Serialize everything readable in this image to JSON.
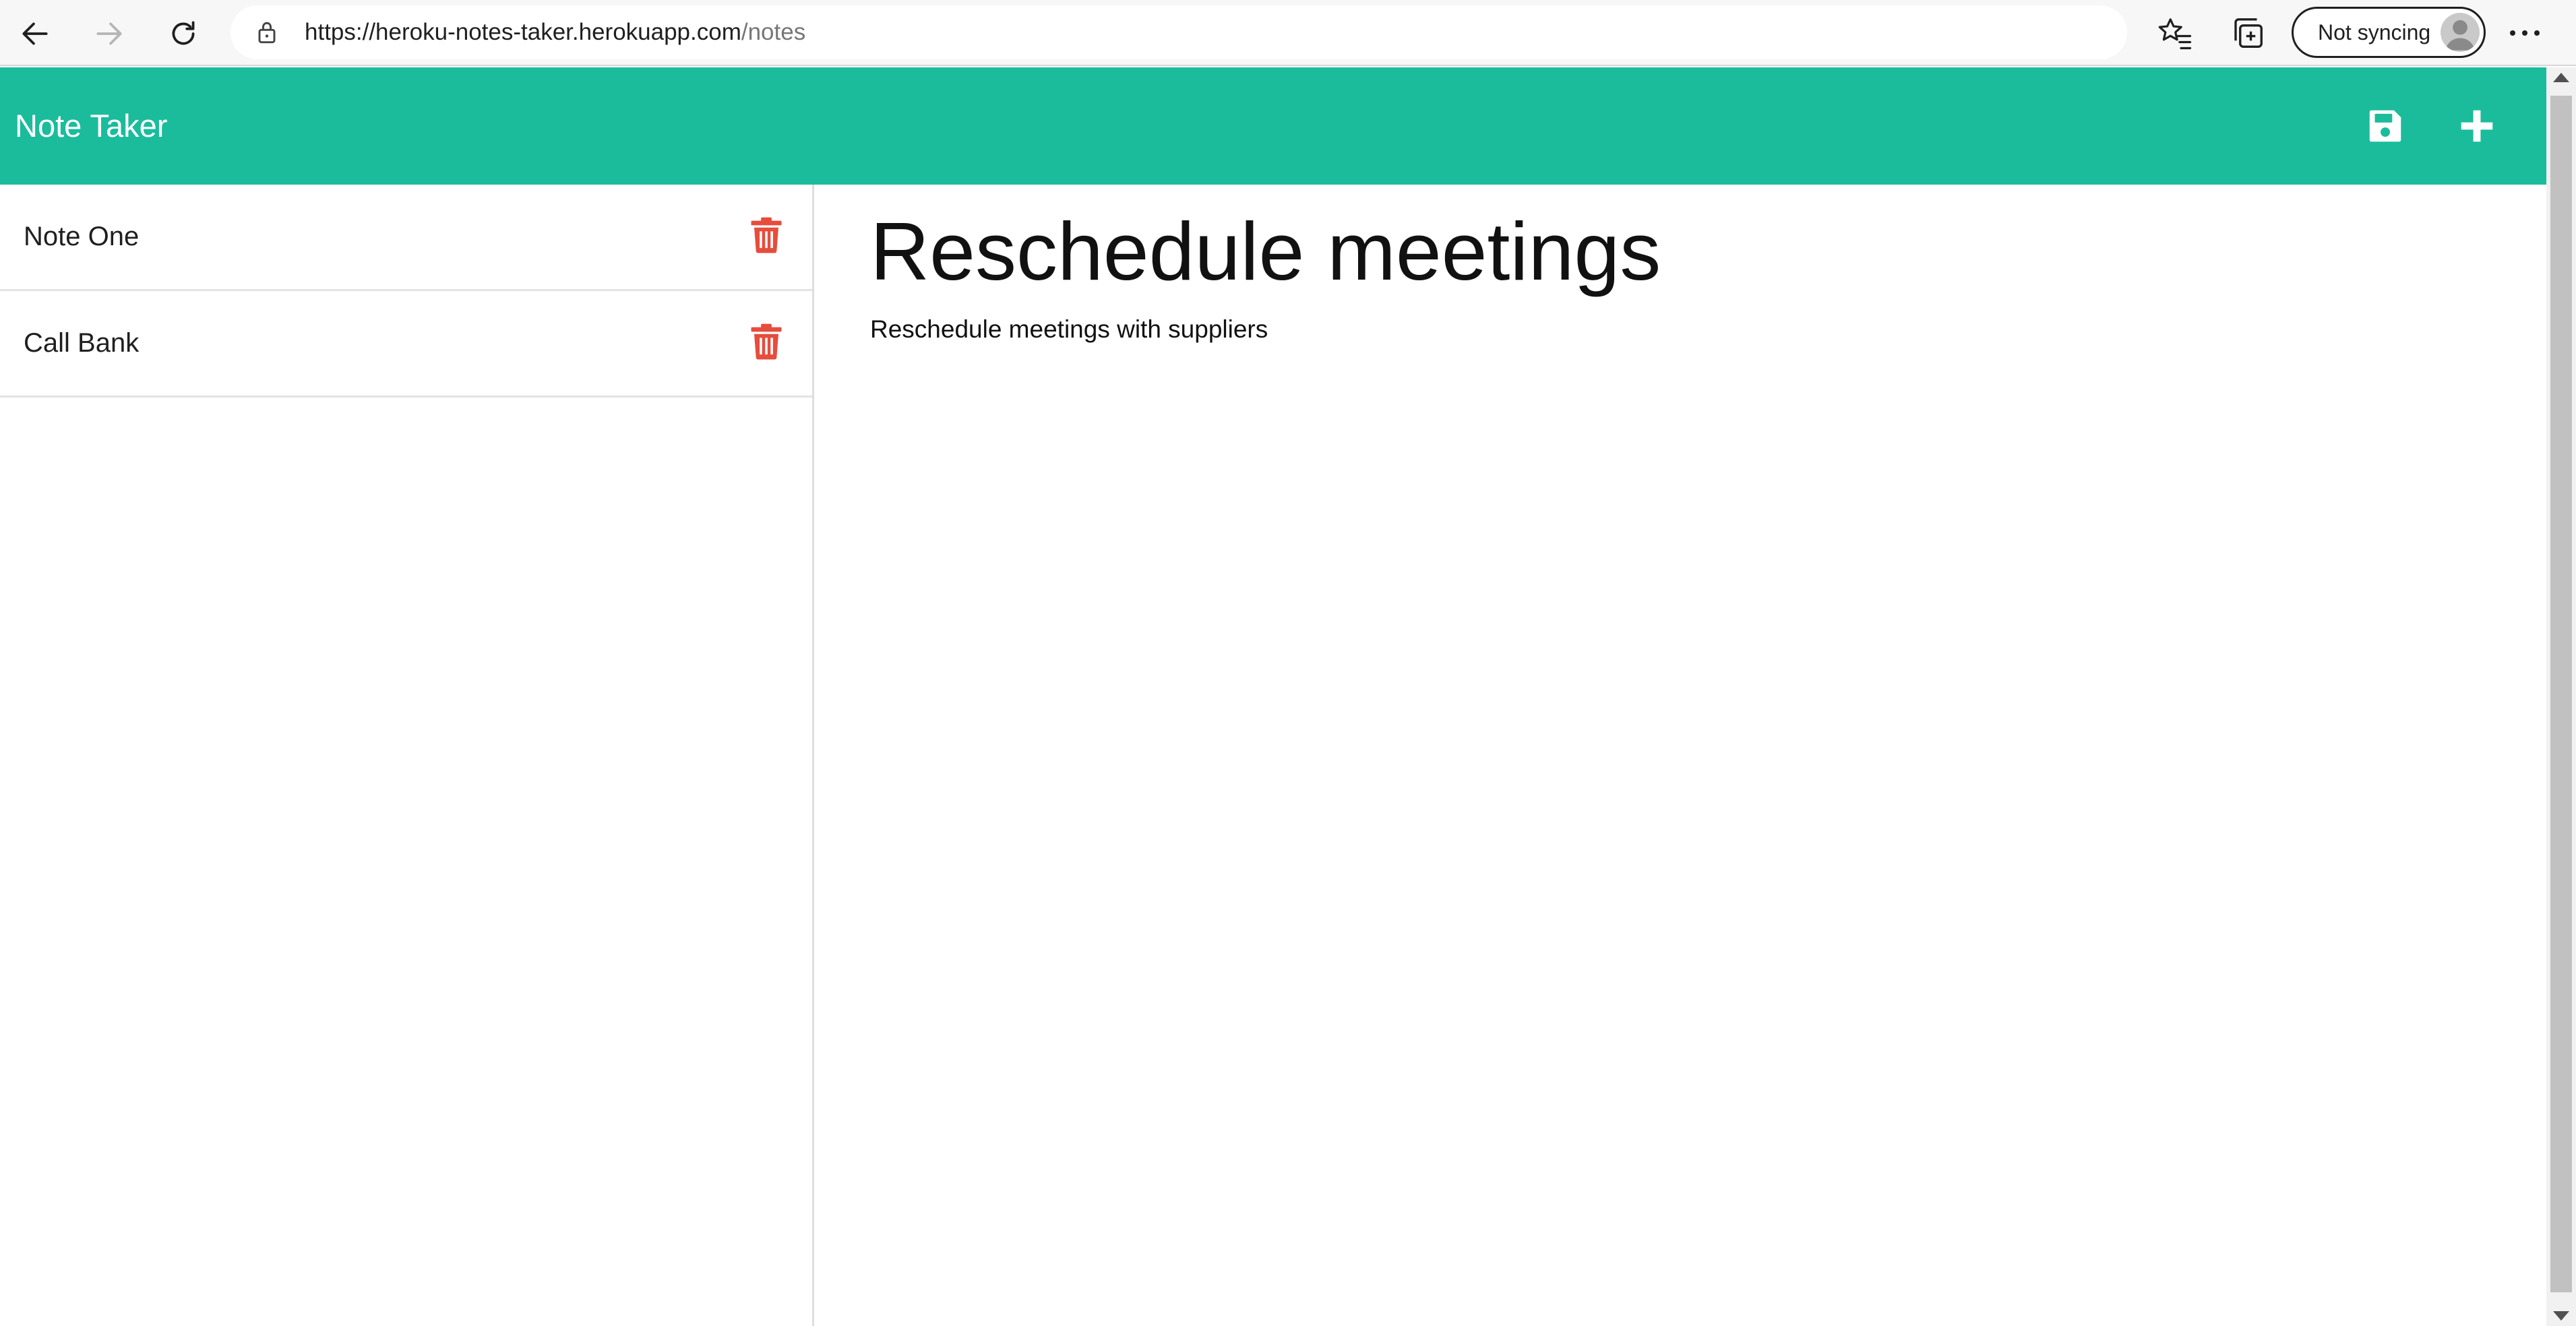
{
  "browser": {
    "url_host": "https://heroku-notes-taker.herokuapp.com",
    "url_path": "/notes",
    "sync_label": "Not syncing",
    "icons": [
      "back-icon",
      "forward-icon",
      "refresh-icon",
      "lock-icon",
      "add-favorite-icon",
      "favorites-icon",
      "collections-icon",
      "avatar-icon",
      "more-icon"
    ]
  },
  "app": {
    "title": "Note Taker",
    "accent_color": "#1abc9c",
    "actions": [
      "save-icon",
      "plus-icon"
    ]
  },
  "notes": [
    {
      "title": "Note One"
    },
    {
      "title": "Call Bank"
    }
  ],
  "delete_color": "#e74c3c",
  "active_note": {
    "title": "Reschedule meetings",
    "text": "Reschedule meetings with suppliers"
  }
}
